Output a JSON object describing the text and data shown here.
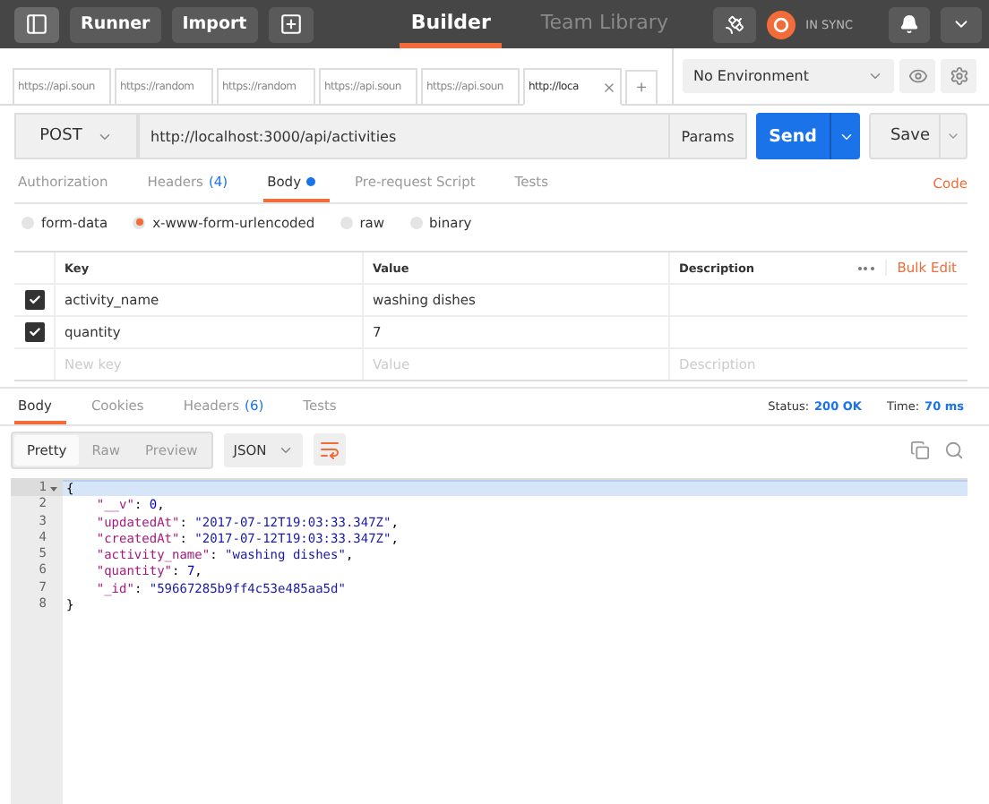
{
  "topbar": {
    "buttons": [
      "Runner",
      "Import"
    ],
    "nav": [
      {
        "label": "Builder",
        "selected": true
      },
      {
        "label": "Team Library",
        "selected": false
      }
    ],
    "sync": "IN SYNC"
  },
  "url_tabs": [
    {
      "label": "https://api.soun",
      "selected": false
    },
    {
      "label": "https://random",
      "selected": false
    },
    {
      "label": "https://random",
      "selected": false
    },
    {
      "label": "https://api.soun",
      "selected": false
    },
    {
      "label": "https://api.soun",
      "selected": false
    },
    {
      "label": "http://loca",
      "selected": true
    }
  ],
  "new_tab": "+",
  "environment": "No Environment",
  "request": {
    "method": "POST",
    "url": "http://localhost:3000/api/activities",
    "params": "Params",
    "send": "Send",
    "save": "Save"
  },
  "request_tabs": [
    {
      "label": "Authorization",
      "selected": false
    },
    {
      "label": "Headers",
      "count": "(4)",
      "selected": false
    },
    {
      "label": "Body",
      "modified": true,
      "selected": true
    },
    {
      "label": "Pre-request Script",
      "selected": false
    },
    {
      "label": "Tests",
      "selected": false
    }
  ],
  "code_link": "Code",
  "body_modes": [
    {
      "label": "form-data",
      "selected": false
    },
    {
      "label": "x-www-form-urlencoded",
      "selected": true
    },
    {
      "label": "raw",
      "selected": false
    },
    {
      "label": "binary",
      "selected": false
    }
  ],
  "params": {
    "columns": [
      "Key",
      "Value",
      "Description"
    ],
    "bulk_edit": "Bulk Edit",
    "rows": [
      {
        "key": "activity_name",
        "value": "washing dishes",
        "checked": true
      },
      {
        "key": "quantity",
        "value": "7",
        "checked": true
      }
    ],
    "new_row": {
      "key": {
        "placeholder": "New key"
      },
      "value": {
        "placeholder": "Value"
      },
      "description": {
        "placeholder": "Description"
      }
    }
  },
  "response_tabs": [
    {
      "label": "Body",
      "selected": true
    },
    {
      "label": "Cookies",
      "selected": false
    },
    {
      "label": "Headers",
      "count": "(6)",
      "selected": false
    },
    {
      "label": "Tests",
      "selected": false
    }
  ],
  "status": {
    "label": "Status:",
    "value": "200 OK"
  },
  "time": {
    "label": "Time:",
    "value": "70 ms"
  },
  "view_modes": [
    {
      "label": "Pretty",
      "selected": true
    },
    {
      "label": "Raw",
      "selected": false
    },
    {
      "label": "Preview",
      "selected": false
    }
  ],
  "format": "JSON",
  "code_lines": [
    {
      "number": "1",
      "active": true,
      "tokens": [
        {
          "kind": "punct",
          "text": "{"
        }
      ]
    },
    {
      "number": "2",
      "active": false,
      "tokens": [
        {
          "kind": "key",
          "text": "\"__v\""
        },
        {
          "kind": "punct",
          "text": ": "
        },
        {
          "kind": "number",
          "text": "0"
        },
        {
          "kind": "punct",
          "text": ","
        }
      ]
    },
    {
      "number": "3",
      "active": false,
      "tokens": [
        {
          "kind": "key",
          "text": "\"updatedAt\""
        },
        {
          "kind": "punct",
          "text": ": "
        },
        {
          "kind": "string",
          "text": "\"2017-07-12T19:03:33.347Z\""
        },
        {
          "kind": "punct",
          "text": ","
        }
      ]
    },
    {
      "number": "4",
      "active": false,
      "tokens": [
        {
          "kind": "key",
          "text": "\"createdAt\""
        },
        {
          "kind": "punct",
          "text": ": "
        },
        {
          "kind": "string",
          "text": "\"2017-07-12T19:03:33.347Z\""
        },
        {
          "kind": "punct",
          "text": ","
        }
      ]
    },
    {
      "number": "5",
      "active": false,
      "tokens": [
        {
          "kind": "key",
          "text": "\"activity_name\""
        },
        {
          "kind": "punct",
          "text": ": "
        },
        {
          "kind": "string",
          "text": "\"washing dishes\""
        },
        {
          "kind": "punct",
          "text": ","
        }
      ]
    },
    {
      "number": "6",
      "active": false,
      "tokens": [
        {
          "kind": "key",
          "text": "\"quantity\""
        },
        {
          "kind": "punct",
          "text": ": "
        },
        {
          "kind": "number",
          "text": "7"
        },
        {
          "kind": "punct",
          "text": ","
        }
      ]
    },
    {
      "number": "7",
      "active": false,
      "tokens": [
        {
          "kind": "key",
          "text": "\"_id\""
        },
        {
          "kind": "punct",
          "text": ": "
        },
        {
          "kind": "string",
          "text": "\"59667285b9ff4c53e485aa5d\""
        }
      ]
    },
    {
      "number": "8",
      "active": false,
      "tokens": [
        {
          "kind": "punct",
          "text": "}"
        }
      ]
    }
  ]
}
